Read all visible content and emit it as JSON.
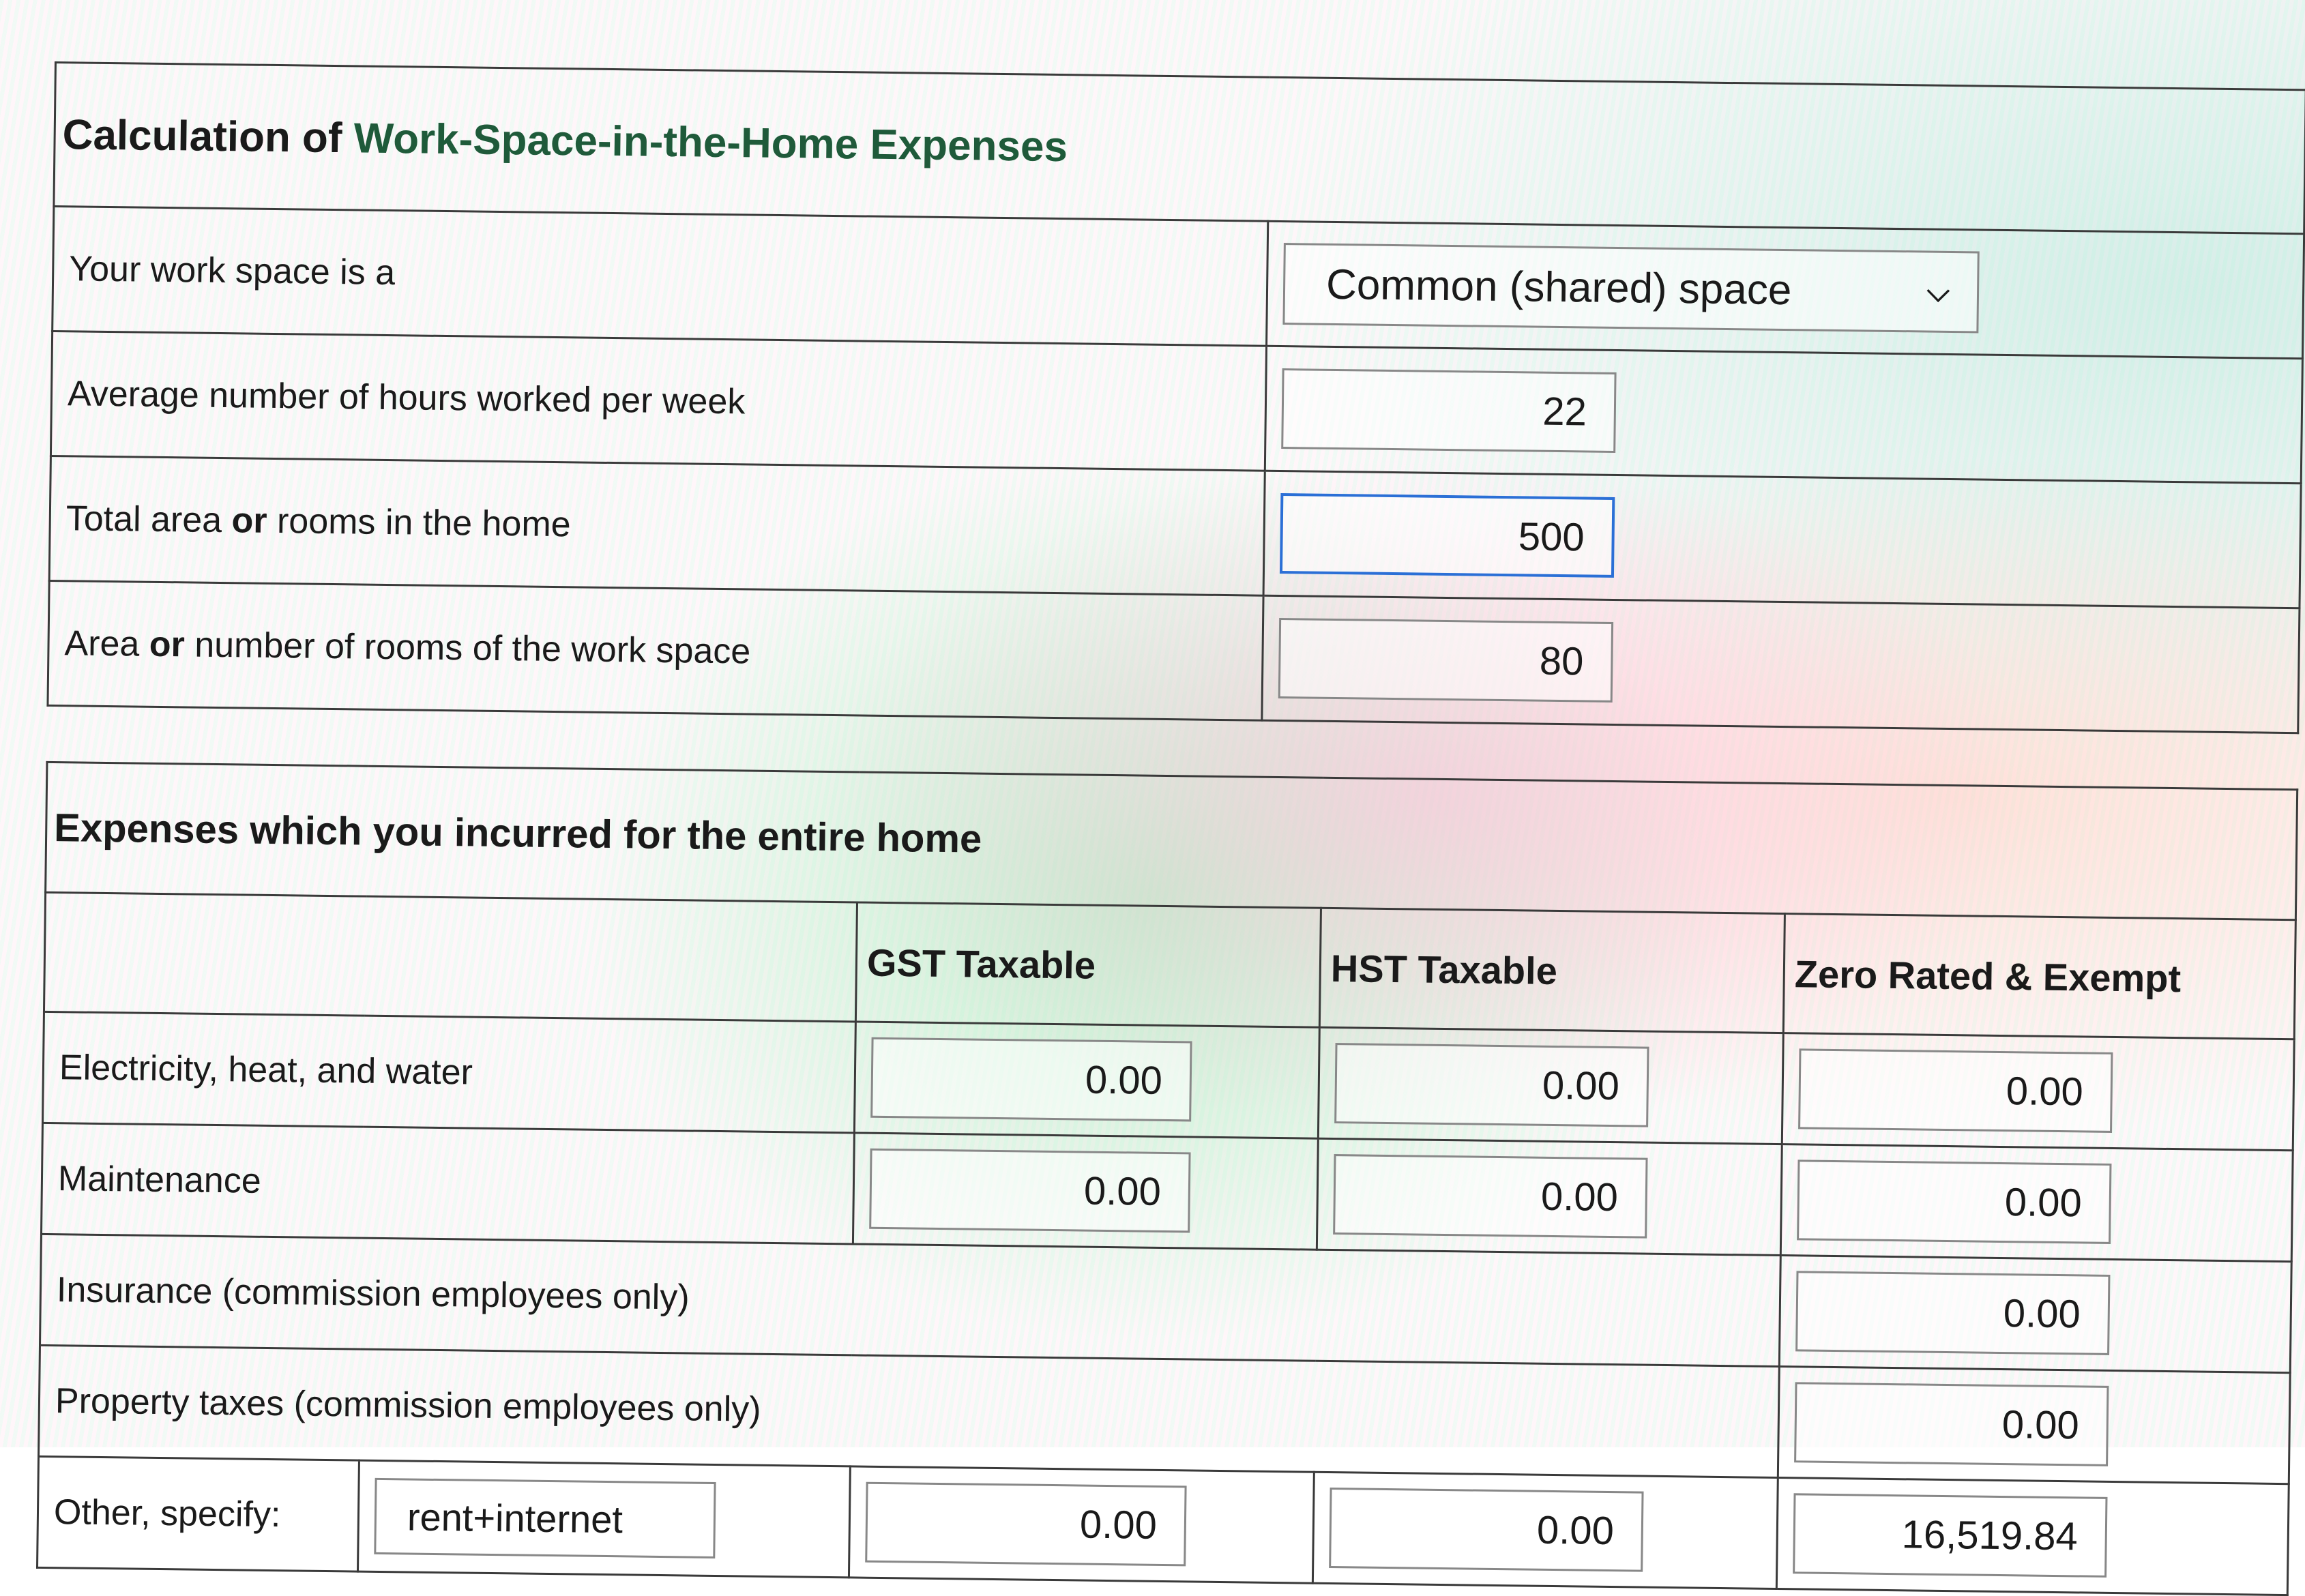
{
  "work_space": {
    "title_prefix": "Calculation of ",
    "title_emphasis": "Work-Space-in-the-Home Expenses",
    "fields": {
      "type_label": "Your work space is a",
      "type_value": "Common (shared) space",
      "hours_label": "Average number of hours worked per week",
      "hours_value": "22",
      "total_area_label_a": "Total area ",
      "total_area_or": "or",
      "total_area_label_b": " rooms in the home",
      "total_area_value": "500",
      "work_area_label_a": "Area ",
      "work_area_or": "or",
      "work_area_label_b": " number of rooms of the work space",
      "work_area_value": "80"
    }
  },
  "expenses": {
    "title": "Expenses which you incurred for the entire home",
    "columns": {
      "gst": "GST Taxable",
      "hst": "HST Taxable",
      "zero": "Zero Rated & Exempt"
    },
    "rows": {
      "utilities": {
        "label": "Electricity, heat, and water",
        "gst": "0.00",
        "hst": "0.00",
        "zero": "0.00"
      },
      "maintenance": {
        "label": "Maintenance",
        "gst": "0.00",
        "hst": "0.00",
        "zero": "0.00"
      },
      "insurance": {
        "label": "Insurance (commission employees only)",
        "zero": "0.00"
      },
      "property_taxes": {
        "label": "Property taxes (commission employees only)",
        "zero": "0.00"
      },
      "other": {
        "label": "Other, specify:",
        "specify": "rent+internet",
        "gst": "0.00",
        "hst": "0.00",
        "zero": "16,519.84"
      }
    }
  },
  "colors": {
    "title_accent": "#1f5a3a",
    "focus_border": "#2b6fd6"
  }
}
